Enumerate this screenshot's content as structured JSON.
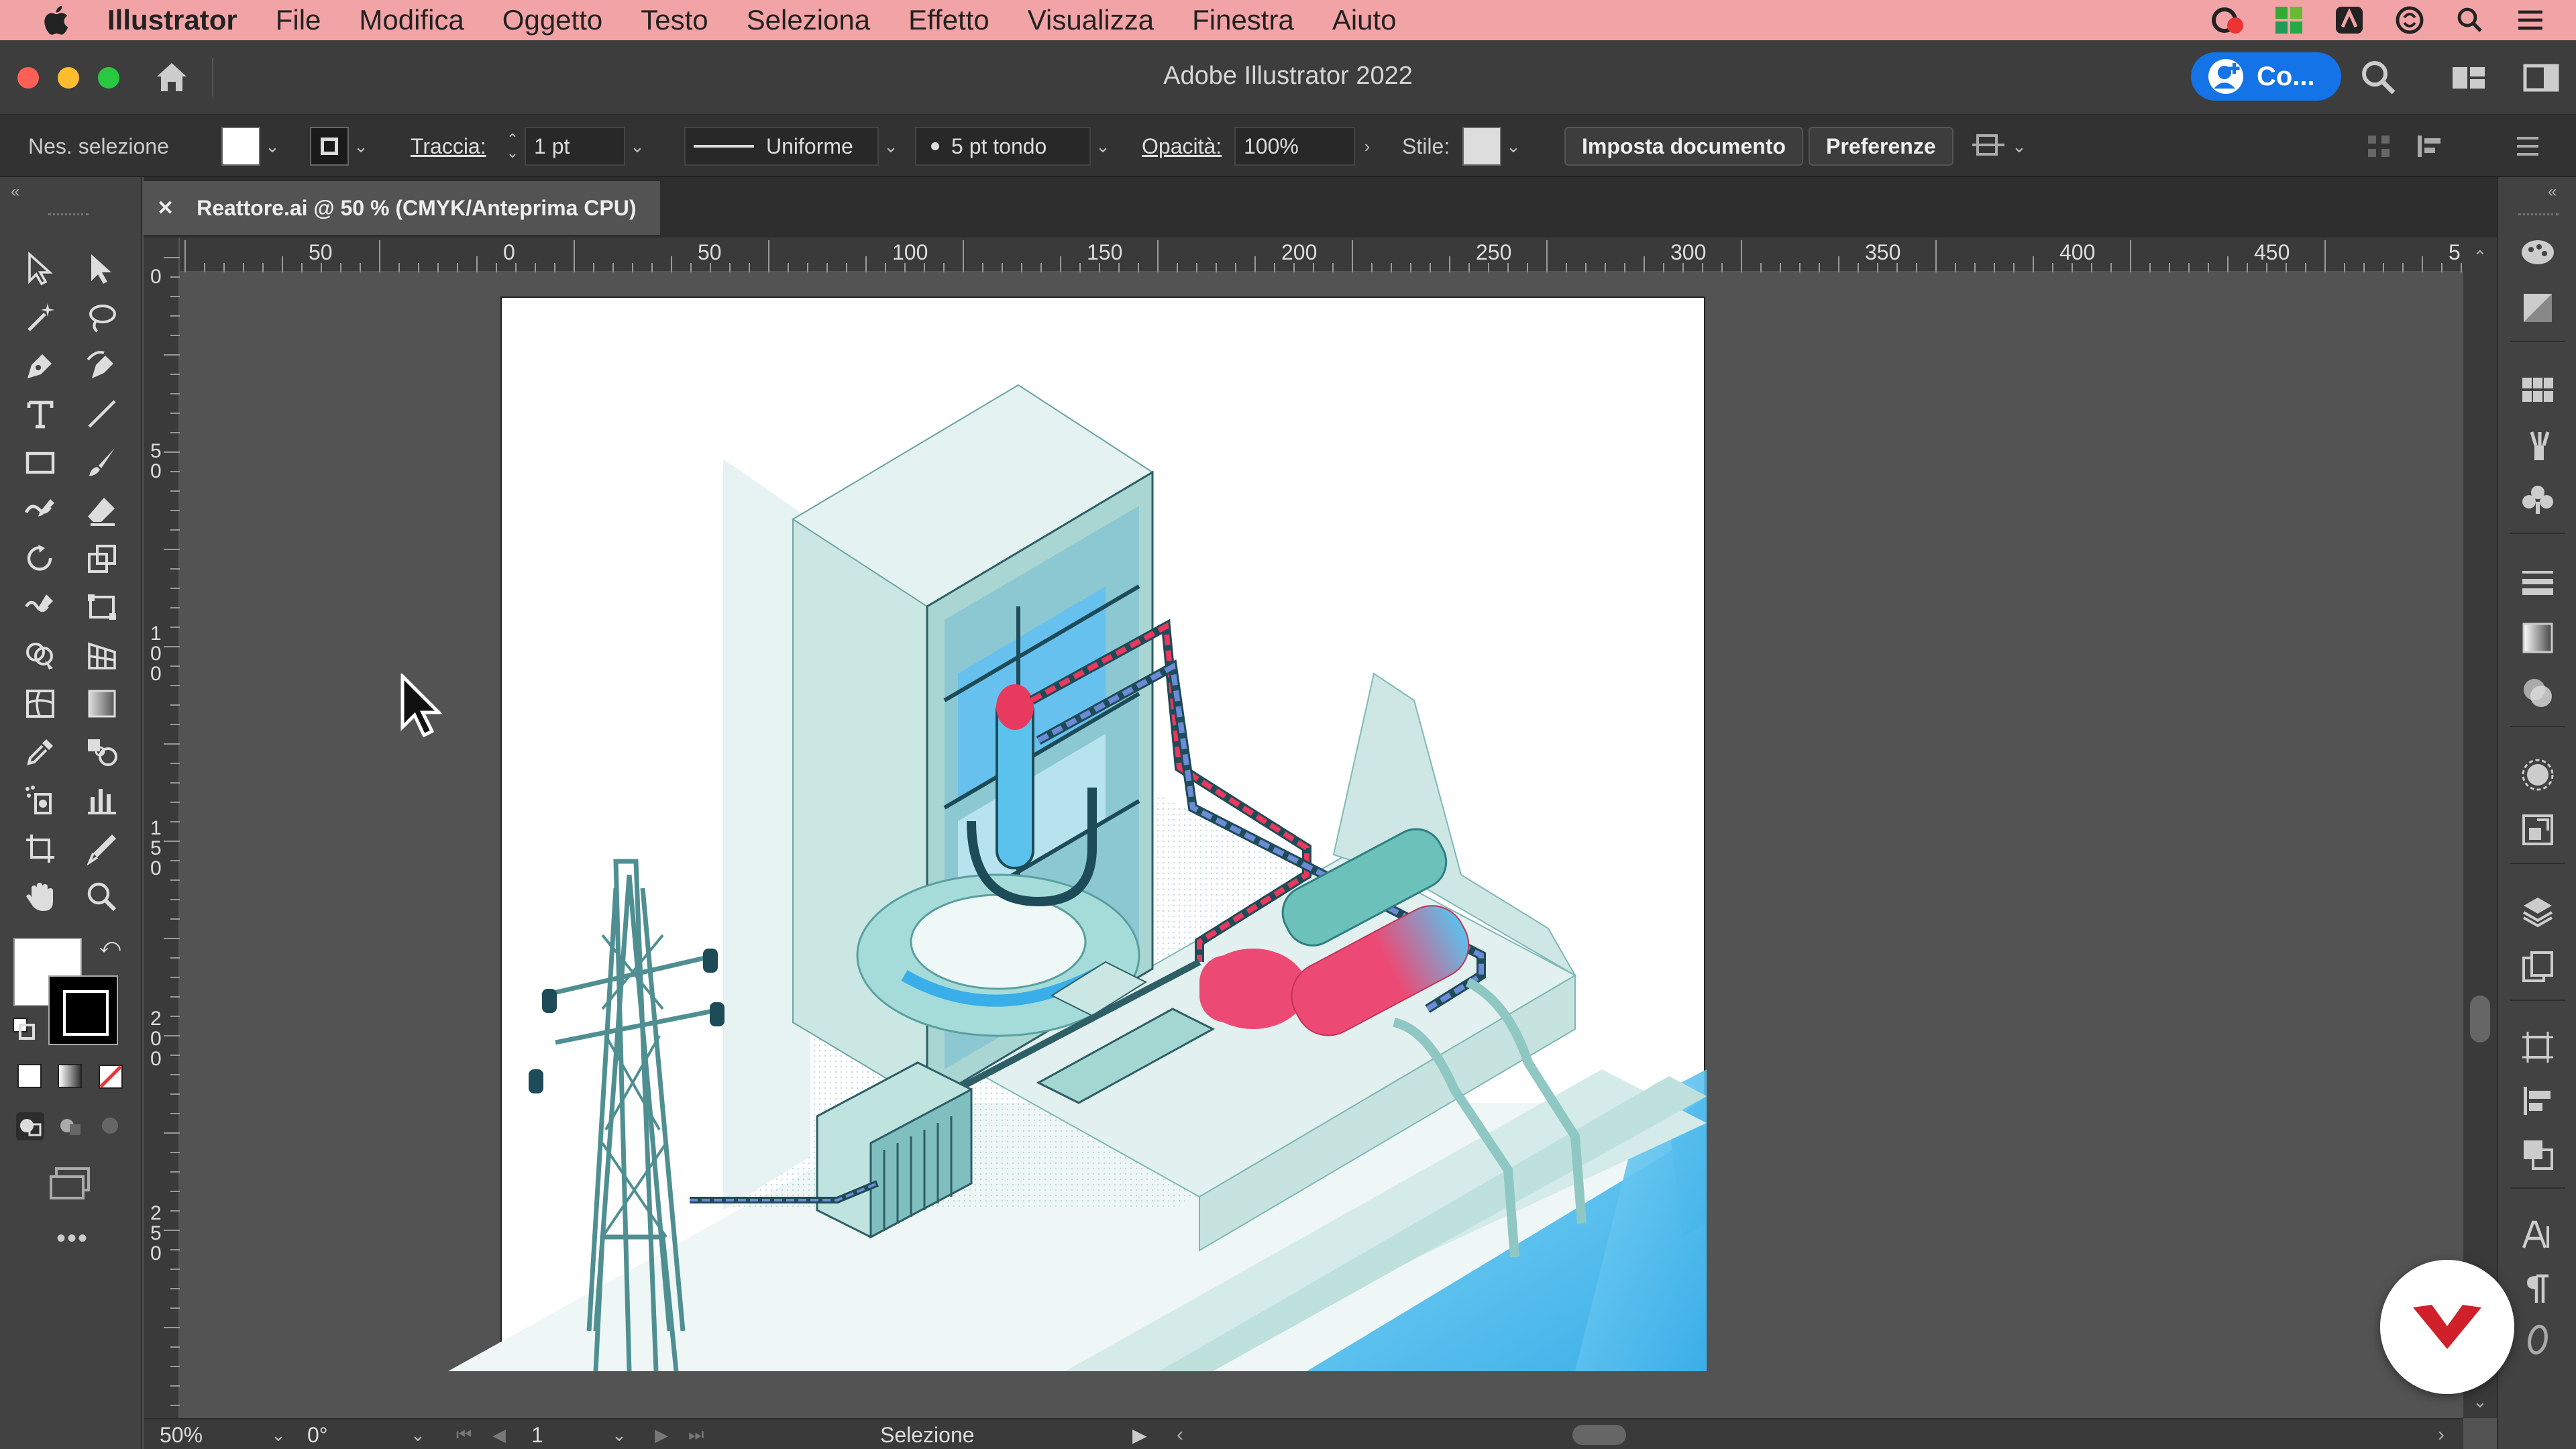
{
  "menubar": {
    "app": "Illustrator",
    "items": [
      "File",
      "Modifica",
      "Oggetto",
      "Testo",
      "Seleziona",
      "Effetto",
      "Visualizza",
      "Finestra",
      "Aiuto"
    ]
  },
  "titlebar": {
    "title": "Adobe Illustrator 2022",
    "cloud_label": "Co..."
  },
  "controlbar": {
    "selection_status": "Nes. selezione",
    "stroke_label": "Traccia:",
    "stroke_weight": "1 pt",
    "stroke_profile": "Uniforme",
    "brush": "5 pt tondo",
    "opacity_label": "Opacità:",
    "opacity_value": "100%",
    "style_label": "Stile:",
    "document_setup_button": "Imposta documento",
    "preferences_button": "Preferenze"
  },
  "document": {
    "tab_title": "Reattore.ai @ 50 % (CMYK/Anteprima CPU)"
  },
  "rulers": {
    "top_labels": [
      "50",
      "0",
      "50",
      "100",
      "150",
      "200",
      "250",
      "300",
      "350",
      "400",
      "450",
      "5"
    ],
    "left_labels": [
      "0",
      "5 0",
      "1 0 0",
      "1 5 0",
      "2 0 0",
      "2 5 0"
    ]
  },
  "statusbar": {
    "zoom": "50%",
    "rotation": "0°",
    "artboard_number": "1",
    "current_tool": "Selezione"
  },
  "colors": {
    "menubar_bg": "#f2a3a6",
    "accent_blue": "#1473e6",
    "illustration_teal": "#bfe3df",
    "illustration_red": "#e8395f",
    "water_blue": "#5bc2ee"
  }
}
